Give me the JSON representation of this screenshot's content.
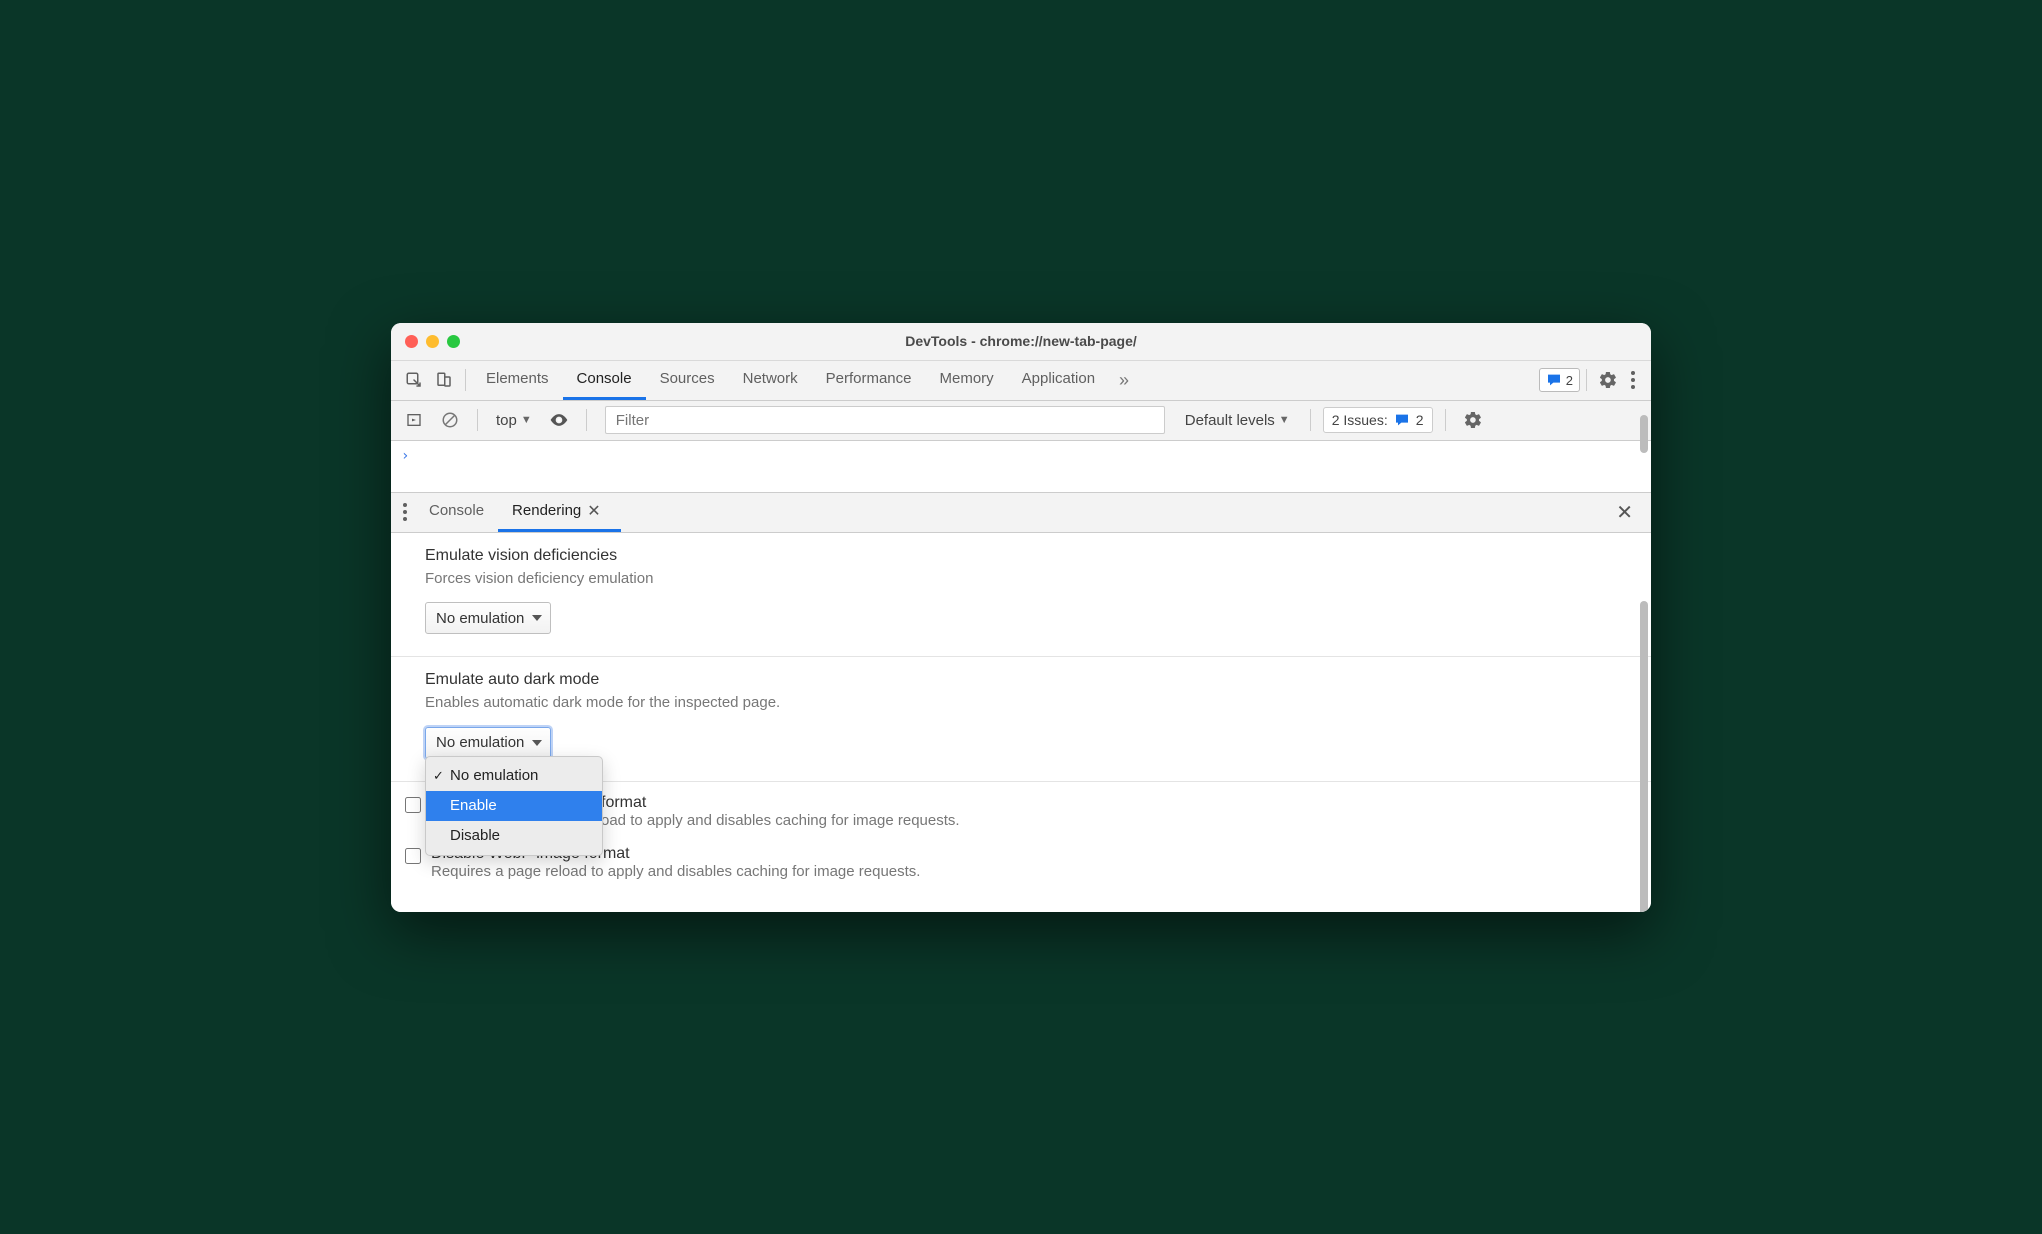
{
  "window": {
    "title": "DevTools - chrome://new-tab-page/"
  },
  "mainTabs": {
    "elements": "Elements",
    "console": "Console",
    "sources": "Sources",
    "network": "Network",
    "performance": "Performance",
    "memory": "Memory",
    "application": "Application"
  },
  "badges": {
    "feedbackCount": "2",
    "issuesLabel": "2 Issues:",
    "issuesCount": "2"
  },
  "consoleToolbar": {
    "context": "top",
    "filterPlaceholder": "Filter",
    "levels": "Default levels"
  },
  "drawer": {
    "consoleTab": "Console",
    "renderingTab": "Rendering"
  },
  "rendering": {
    "vision": {
      "title": "Emulate vision deficiencies",
      "desc": "Forces vision deficiency emulation",
      "selected": "No emulation"
    },
    "darkMode": {
      "title": "Emulate auto dark mode",
      "desc": "Enables automatic dark mode for the inspected page.",
      "selected": "No emulation",
      "options": {
        "none": "No emulation",
        "enable": "Enable",
        "disable": "Disable"
      }
    },
    "avif": {
      "titleVisible": "format",
      "descVisible": "oad to apply and disables caching for image requests."
    },
    "webp": {
      "title": "Disable WebP image format",
      "desc": "Requires a page reload to apply and disables caching for image requests."
    }
  }
}
